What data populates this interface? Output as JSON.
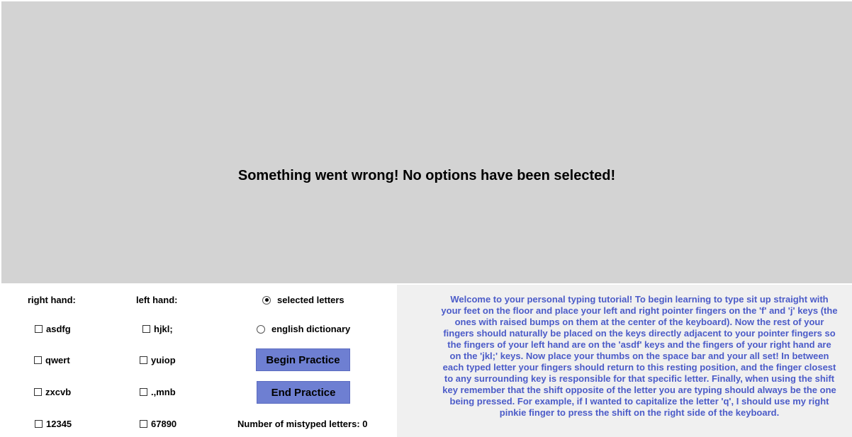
{
  "display": {
    "message": "Something went wrong! No options have been selected!"
  },
  "controls": {
    "right_hand": {
      "heading": "right hand:",
      "options": [
        {
          "label": "asdfg",
          "checked": false
        },
        {
          "label": "qwert",
          "checked": false
        },
        {
          "label": "zxcvb",
          "checked": false
        },
        {
          "label": "12345",
          "checked": false
        }
      ]
    },
    "left_hand": {
      "heading": "left hand:",
      "options": [
        {
          "label": "hjkl;",
          "checked": false
        },
        {
          "label": "yuiop",
          "checked": false
        },
        {
          "label": ".,mnb",
          "checked": false
        },
        {
          "label": "67890",
          "checked": false
        }
      ]
    },
    "mode": {
      "options": [
        {
          "label": "selected letters",
          "checked": true
        },
        {
          "label": "english dictionary",
          "checked": false
        }
      ]
    },
    "begin_label": "Begin Practice",
    "end_label": "End Practice",
    "mistyped_text": "Number of mistyped letters: 0"
  },
  "tutorial": {
    "text": "Welcome to your personal typing tutorial! To begin learning to type sit up straight with your feet on the floor and place your left and right pointer fingers on the 'f' and 'j' keys (the ones with raised bumps on them at the center of the keyboard). Now the rest of your fingers should naturally be placed on the keys directly adjacent to your pointer fingers so the fingers of your left hand are on the 'asdf' keys and the fingers of your right hand are on the 'jkl;' keys. Now place your thumbs on the space bar and your all set! In between each typed letter your fingers should return to this resting position, and the finger closest to any surrounding key is responsible for that specific letter. Finally, when using the shift key remember that the shift opposite of the letter you are typing should always be the one being pressed. For example, if I wanted to capitalize the letter 'q', I should use my right pinkie finger to press the shift on the right side of the keyboard.",
    "color": "#4b5bc8"
  },
  "colors": {
    "display_bg": "#d3d3d3",
    "button_bg": "#6e7fd2",
    "tutorial_bg": "#f0f0f0"
  }
}
